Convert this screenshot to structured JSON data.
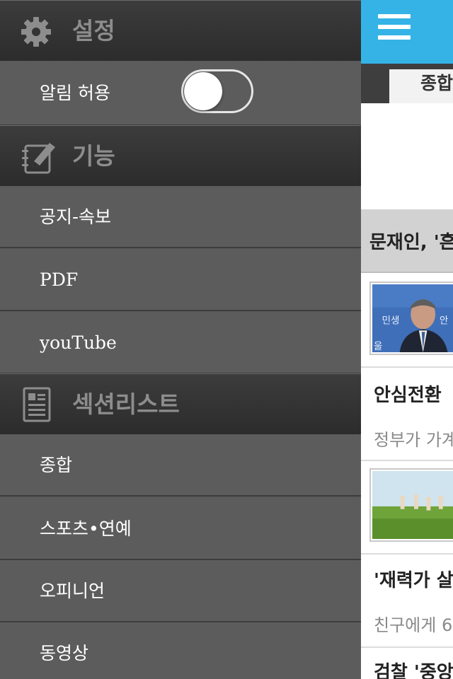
{
  "drawer": {
    "settings": {
      "title": "설정",
      "icon": "gear-icon",
      "notification_label": "알림 허용",
      "notification_enabled": false
    },
    "features": {
      "title": "기능",
      "icon": "notepad-pencil-icon",
      "items": [
        {
          "label": "공지-속보"
        },
        {
          "label": "PDF"
        },
        {
          "label": "youTube"
        }
      ]
    },
    "sections": {
      "title": "섹션리스트",
      "icon": "document-list-icon",
      "items": [
        {
          "label": "종합"
        },
        {
          "label": "스포츠•연예"
        },
        {
          "label": "오피니언"
        },
        {
          "label": "동영상"
        }
      ]
    }
  },
  "main": {
    "menu_icon": "hamburger-menu-icon",
    "active_tab": "종합",
    "headline": "문재인, '흔",
    "stories": [
      {
        "thumb_caption": "민생  안심  울",
        "title": "",
        "subtitle": ""
      },
      {
        "title": "안심전환",
        "subtitle": "정부가 가계"
      },
      {
        "title": "'재력가 살",
        "subtitle": "친구에게 6"
      },
      {
        "title": "검찰 '중앙"
      }
    ],
    "colors": {
      "topbar": "#35b3e6",
      "drawer_bg": "#5c5c5c",
      "section_header": "#333333"
    }
  }
}
